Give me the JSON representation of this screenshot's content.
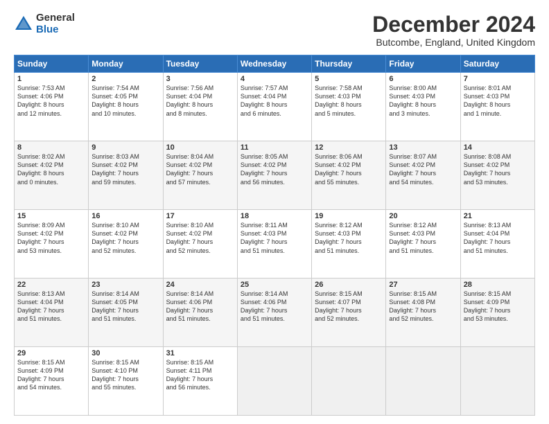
{
  "logo": {
    "general": "General",
    "blue": "Blue"
  },
  "title": "December 2024",
  "subtitle": "Butcombe, England, United Kingdom",
  "calendar": {
    "headers": [
      "Sunday",
      "Monday",
      "Tuesday",
      "Wednesday",
      "Thursday",
      "Friday",
      "Saturday"
    ],
    "rows": [
      [
        {
          "day": "1",
          "text": "Sunrise: 7:53 AM\nSunset: 4:06 PM\nDaylight: 8 hours\nand 12 minutes."
        },
        {
          "day": "2",
          "text": "Sunrise: 7:54 AM\nSunset: 4:05 PM\nDaylight: 8 hours\nand 10 minutes."
        },
        {
          "day": "3",
          "text": "Sunrise: 7:56 AM\nSunset: 4:04 PM\nDaylight: 8 hours\nand 8 minutes."
        },
        {
          "day": "4",
          "text": "Sunrise: 7:57 AM\nSunset: 4:04 PM\nDaylight: 8 hours\nand 6 minutes."
        },
        {
          "day": "5",
          "text": "Sunrise: 7:58 AM\nSunset: 4:03 PM\nDaylight: 8 hours\nand 5 minutes."
        },
        {
          "day": "6",
          "text": "Sunrise: 8:00 AM\nSunset: 4:03 PM\nDaylight: 8 hours\nand 3 minutes."
        },
        {
          "day": "7",
          "text": "Sunrise: 8:01 AM\nSunset: 4:03 PM\nDaylight: 8 hours\nand 1 minute."
        }
      ],
      [
        {
          "day": "8",
          "text": "Sunrise: 8:02 AM\nSunset: 4:02 PM\nDaylight: 8 hours\nand 0 minutes."
        },
        {
          "day": "9",
          "text": "Sunrise: 8:03 AM\nSunset: 4:02 PM\nDaylight: 7 hours\nand 59 minutes."
        },
        {
          "day": "10",
          "text": "Sunrise: 8:04 AM\nSunset: 4:02 PM\nDaylight: 7 hours\nand 57 minutes."
        },
        {
          "day": "11",
          "text": "Sunrise: 8:05 AM\nSunset: 4:02 PM\nDaylight: 7 hours\nand 56 minutes."
        },
        {
          "day": "12",
          "text": "Sunrise: 8:06 AM\nSunset: 4:02 PM\nDaylight: 7 hours\nand 55 minutes."
        },
        {
          "day": "13",
          "text": "Sunrise: 8:07 AM\nSunset: 4:02 PM\nDaylight: 7 hours\nand 54 minutes."
        },
        {
          "day": "14",
          "text": "Sunrise: 8:08 AM\nSunset: 4:02 PM\nDaylight: 7 hours\nand 53 minutes."
        }
      ],
      [
        {
          "day": "15",
          "text": "Sunrise: 8:09 AM\nSunset: 4:02 PM\nDaylight: 7 hours\nand 53 minutes."
        },
        {
          "day": "16",
          "text": "Sunrise: 8:10 AM\nSunset: 4:02 PM\nDaylight: 7 hours\nand 52 minutes."
        },
        {
          "day": "17",
          "text": "Sunrise: 8:10 AM\nSunset: 4:02 PM\nDaylight: 7 hours\nand 52 minutes."
        },
        {
          "day": "18",
          "text": "Sunrise: 8:11 AM\nSunset: 4:03 PM\nDaylight: 7 hours\nand 51 minutes."
        },
        {
          "day": "19",
          "text": "Sunrise: 8:12 AM\nSunset: 4:03 PM\nDaylight: 7 hours\nand 51 minutes."
        },
        {
          "day": "20",
          "text": "Sunrise: 8:12 AM\nSunset: 4:03 PM\nDaylight: 7 hours\nand 51 minutes."
        },
        {
          "day": "21",
          "text": "Sunrise: 8:13 AM\nSunset: 4:04 PM\nDaylight: 7 hours\nand 51 minutes."
        }
      ],
      [
        {
          "day": "22",
          "text": "Sunrise: 8:13 AM\nSunset: 4:04 PM\nDaylight: 7 hours\nand 51 minutes."
        },
        {
          "day": "23",
          "text": "Sunrise: 8:14 AM\nSunset: 4:05 PM\nDaylight: 7 hours\nand 51 minutes."
        },
        {
          "day": "24",
          "text": "Sunrise: 8:14 AM\nSunset: 4:06 PM\nDaylight: 7 hours\nand 51 minutes."
        },
        {
          "day": "25",
          "text": "Sunrise: 8:14 AM\nSunset: 4:06 PM\nDaylight: 7 hours\nand 51 minutes."
        },
        {
          "day": "26",
          "text": "Sunrise: 8:15 AM\nSunset: 4:07 PM\nDaylight: 7 hours\nand 52 minutes."
        },
        {
          "day": "27",
          "text": "Sunrise: 8:15 AM\nSunset: 4:08 PM\nDaylight: 7 hours\nand 52 minutes."
        },
        {
          "day": "28",
          "text": "Sunrise: 8:15 AM\nSunset: 4:09 PM\nDaylight: 7 hours\nand 53 minutes."
        }
      ],
      [
        {
          "day": "29",
          "text": "Sunrise: 8:15 AM\nSunset: 4:09 PM\nDaylight: 7 hours\nand 54 minutes."
        },
        {
          "day": "30",
          "text": "Sunrise: 8:15 AM\nSunset: 4:10 PM\nDaylight: 7 hours\nand 55 minutes."
        },
        {
          "day": "31",
          "text": "Sunrise: 8:15 AM\nSunset: 4:11 PM\nDaylight: 7 hours\nand 56 minutes."
        },
        {
          "day": "",
          "text": ""
        },
        {
          "day": "",
          "text": ""
        },
        {
          "day": "",
          "text": ""
        },
        {
          "day": "",
          "text": ""
        }
      ]
    ]
  }
}
